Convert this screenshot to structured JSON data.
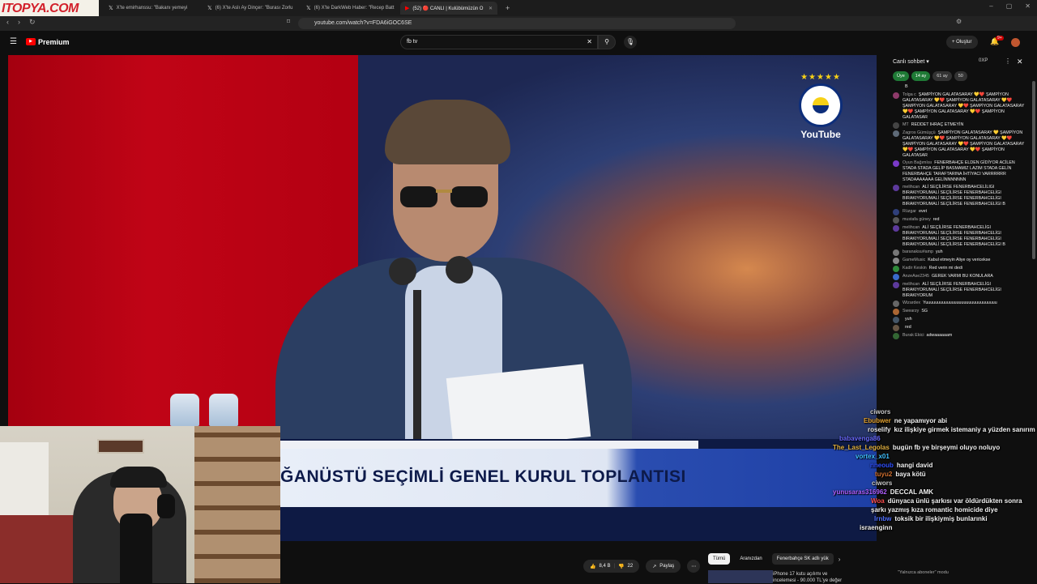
{
  "browser": {
    "tabs": [
      {
        "label": "X'te emirhanssu: \"Bakanı yemeyi",
        "active": false
      },
      {
        "label": "(6) X'te Aslı Ay Dinçer: \"Burası Zorlu",
        "active": false
      },
      {
        "label": "(6) X'te DarkWeb Haber: \"Recep Batt",
        "active": false
      },
      {
        "label": "(52) 🔴 CANLI | Kulübümüzün O",
        "active": true
      }
    ],
    "url": "youtube.com/watch?v=FDA6iGOC6SE",
    "watermark": "ITOPYA.COM"
  },
  "youtube": {
    "logo": "Premium",
    "search_value": "fb tv",
    "create_label": "Oluştur",
    "notif_count": "9+"
  },
  "video": {
    "banner_text": "ĞANÜSTÜ SEÇİMLİ GENEL KURUL TOPLANTISI",
    "channel_watermark": "YouTube",
    "stars": "★★★★★"
  },
  "actions": {
    "likes": "8,4 B",
    "dislikes": "22",
    "share": "Paylaş"
  },
  "chips": [
    "Tümü",
    "Aranızdan",
    "Fenerbahçe SK adlı yük"
  ],
  "recommended": {
    "title": "iPhone 17 kutu açılımı ve incelemesi - 90.000 TL'ye değer"
  },
  "chat": {
    "title": "Canlı sohbet",
    "header_badge": "0XP",
    "badges": [
      "Üye",
      "14 ay",
      "61 ay",
      "50"
    ],
    "footer": "\"Yalnızca aboneler\" modu",
    "messages": [
      {
        "author": "",
        "text": "B"
      },
      {
        "author": "Tolga c",
        "text": "ŞAMPİYON GALATASARAY 💛❤️ ŞAMPİYON GALATASARAY 💛❤️ ŞAMPİYON GALATASARAY 💛❤️ ŞAMPİYON GALATASARAY 💛❤️ ŞAMPİYON GALATASARAY 💛❤️ ŞAMPİYON GALATASARAY 💛❤️ ŞAMPİYON GALATASAR"
      },
      {
        "author": "MT",
        "text": "REDDET IHRAÇ ETMEYİN"
      },
      {
        "author": "Zagros Gümüşçü",
        "text": "ŞAMPİYON GALATASARAY 💛 ŞAMPİYON GALATASARAY 💛❤️ ŞAMPİYON GALATASARAY 💛❤️ ŞAMPİYON GALATASARAY 💛❤️ ŞAMPİYON GALATASARAY 💛❤️ ŞAMPİYON GALATASARAY 💛❤️ ŞAMPİYON GALATASAR"
      },
      {
        "author": "Oyun Bağımlısı",
        "text": "FENERBAHÇE ELDEN GİDİYOR ACİLEN STADA STADA GELİP BASMAMIZ LAZIM STADA GELİN FENERBAHÇE TARAFTARINA İHTİYACI VARRRRRR STADAAAAAAA GELİNNNNNNN"
      },
      {
        "author": "melihcan",
        "text": "ALİ SEÇİLİRSE FENERBAHCELİLIGI BIRAKIYORUMALİ SEÇİLİRSE FENERBAHCELİGI BIRAKIYORUMALİ SEÇİLİRSE FENERBAHCELİGI BIRAKIYORUMALİ SEÇİLİRSE FENERBAHCELİGI B"
      },
      {
        "author": "Rüzgar",
        "text": "evet"
      },
      {
        "author": "mustafa güney",
        "text": "red"
      },
      {
        "author": "melihcan",
        "text": "ALİ SEÇİLİRSE FENERBAHCELİGI BIRAKIYORUMALİ SEÇİLİRSE FENERBAHCELİGI BIRAKIYORUMALİ SEÇİLİRSE FENERBAHCELİGI BIRAKIYORUMALİ SEÇİLİRSE FENERBAHCELİGI B"
      },
      {
        "author": "baranaksu#amp",
        "text": "yuh"
      },
      {
        "author": "GameMusic",
        "text": "Kabul etmeyin Aliye oy vericekse"
      },
      {
        "author": "Kadir Keskin",
        "text": "Red verin mi dedi"
      },
      {
        "author": "AnzeAse2345",
        "text": "GEREK VARMI BU KONULARA"
      },
      {
        "author": "melihcan",
        "text": "ALİ SEÇİLİRSE FENERBAHCELİGI BIRAKIYORUMALİ SEÇİLİRSE FENERBAHCELİGI BIRAKIYORUM"
      },
      {
        "author": "Wizardex",
        "text": "Yuuuuuuuuuuuuuuuuuuuuuuuuuuuuuu"
      },
      {
        "author": "Swearzy",
        "text": "SG"
      },
      {
        "author": "",
        "text": "yuh"
      },
      {
        "author": "",
        "text": "red"
      },
      {
        "author": "Burak Ekici",
        "text": "adwaaaaaam"
      }
    ]
  },
  "overlay_chat": [
    {
      "name": "ciwors",
      "color": "#c8c8c8",
      "text": ""
    },
    {
      "name": "Ebubwer",
      "color": "#e0a030",
      "text": "ne yapamıyor abi"
    },
    {
      "name": "roselify",
      "color": "#e8e8e8",
      "text": "kız ilişkiye girmek istemaniy a yüzden sanırım"
    },
    {
      "name": "babavenga86",
      "color": "#6a6aff",
      "text": ""
    },
    {
      "name": "The_Last_Legolas",
      "color": "#e0b040",
      "text": "bugün fb ye birşeymi oluyo noluyo"
    },
    {
      "name": "vortex_x01",
      "color": "#40c0ff",
      "text": ""
    },
    {
      "name": "nneoub",
      "color": "#3050ff",
      "text": "hangi david"
    },
    {
      "name": "tuyu2",
      "color": "#d07030",
      "text": "baya kötü"
    },
    {
      "name": "ciwors",
      "color": "#c8c8c8",
      "text": ""
    },
    {
      "name": "yunusaras316962",
      "color": "#b060ff",
      "text": "DECCAL AMK"
    },
    {
      "name": "Woa",
      "color": "#ff5050",
      "text": "dünyaca ünlü şarkısı var öldürdükten sonra şarkı yazmış kıza romantic homicide diye"
    },
    {
      "name": "Irnbw",
      "color": "#5070ff",
      "text": "toksik bir ilişkiymiş bunlarınki"
    },
    {
      "name": "",
      "color": "#e0e0e0",
      "text": "israenginn"
    }
  ],
  "colors": {
    "accent_red": "#ff0000",
    "chat_green": "#1f7a36",
    "banner_blue": "#1e3fa5"
  }
}
